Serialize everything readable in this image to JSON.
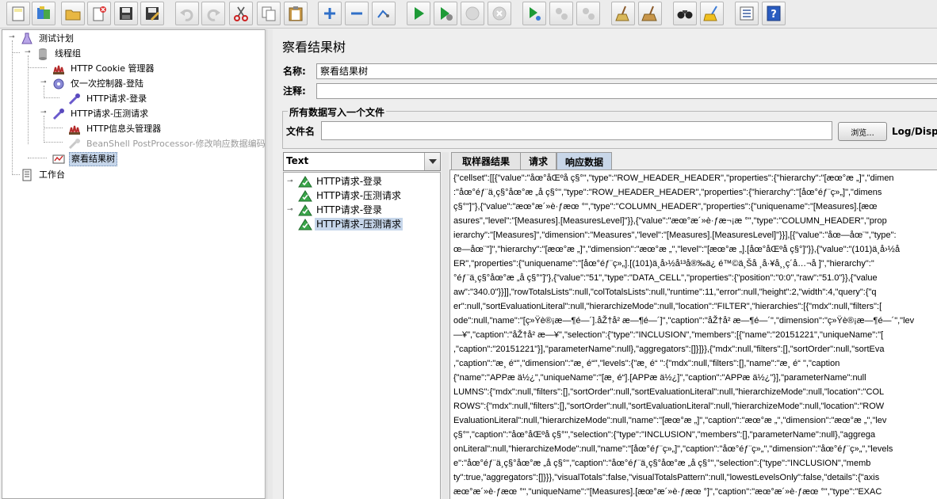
{
  "colors": {
    "selection": "#c6d6ea",
    "run_green": "#1d9a36",
    "disabled_text": "#9a9a9a"
  },
  "toolbar": {
    "buttons": [
      {
        "name": "new-button",
        "icon": "new-icon"
      },
      {
        "name": "templates-button",
        "icon": "templates-icon"
      },
      {
        "name": "open-button",
        "icon": "open-folder-icon"
      },
      {
        "name": "close-button",
        "icon": "close-file-icon"
      },
      {
        "name": "save-button",
        "icon": "save-icon"
      },
      {
        "name": "save-as-button",
        "icon": "save-as-icon"
      },
      {
        "name": "undo-button",
        "icon": "undo-icon"
      },
      {
        "name": "redo-button",
        "icon": "redo-icon"
      },
      {
        "name": "cut-button",
        "icon": "scissors-icon"
      },
      {
        "name": "copy-button",
        "icon": "copy-icon"
      },
      {
        "name": "paste-button",
        "icon": "paste-icon"
      },
      {
        "name": "expand-button",
        "icon": "plus-icon"
      },
      {
        "name": "collapse-button",
        "icon": "minus-icon"
      },
      {
        "name": "toggle-button",
        "icon": "toggle-icon"
      },
      {
        "name": "start-button",
        "icon": "play-icon"
      },
      {
        "name": "start-no-pause-button",
        "icon": "play-no-pause-icon"
      },
      {
        "name": "stop-button",
        "icon": "stop-icon"
      },
      {
        "name": "shutdown-button",
        "icon": "shutdown-icon"
      },
      {
        "name": "remote-start-button",
        "icon": "remote-play-icon"
      },
      {
        "name": "remote-stop-button",
        "icon": "remote-stop-icon"
      },
      {
        "name": "remote-shutdown-button",
        "icon": "remote-shutdown-icon"
      },
      {
        "name": "clear-button",
        "icon": "broom-icon"
      },
      {
        "name": "clear-all-button",
        "icon": "broom-all-icon"
      },
      {
        "name": "search-button",
        "icon": "binoculars-icon"
      },
      {
        "name": "reset-search-button",
        "icon": "reset-broom-icon"
      },
      {
        "name": "function-helper-button",
        "icon": "list-icon"
      },
      {
        "name": "help-button",
        "icon": "help-icon"
      }
    ]
  },
  "tree": {
    "items": [
      {
        "label": "测试计划",
        "icon": "test-plan-icon",
        "disabled": false,
        "selected": false
      },
      {
        "label": "线程组",
        "icon": "thread-group-icon",
        "disabled": false,
        "selected": false
      },
      {
        "label": "HTTP Cookie 管理器",
        "icon": "config-element-icon",
        "disabled": false,
        "selected": false
      },
      {
        "label": "仅一次控制器-登陆",
        "icon": "controller-icon",
        "disabled": false,
        "selected": false
      },
      {
        "label": "HTTP请求-登录",
        "icon": "sampler-pipette-icon",
        "disabled": false,
        "selected": false
      },
      {
        "label": "HTTP请求-压测请求",
        "icon": "sampler-pipette-icon",
        "disabled": false,
        "selected": false
      },
      {
        "label": "HTTP信息头管理器",
        "icon": "config-element-icon",
        "disabled": false,
        "selected": false
      },
      {
        "label": "BeanShell PostProcessor-修改响应数据编码",
        "icon": "postprocessor-icon",
        "disabled": true,
        "selected": false
      },
      {
        "label": "察看结果树",
        "icon": "listener-icon",
        "disabled": false,
        "selected": true
      },
      {
        "label": "工作台",
        "icon": "workbench-icon",
        "disabled": false,
        "selected": false
      }
    ]
  },
  "panel": {
    "title": "察看结果树",
    "name_label": "名称:",
    "name_value": "察看结果树",
    "comment_label": "注释:",
    "comment_value": "",
    "file_group_title": "所有数据写入一个文件",
    "filename_label": "文件名",
    "filename_value": "",
    "browse_label": "浏览...",
    "log_display_label": "Log/Disp"
  },
  "renderer": {
    "selected": "Text"
  },
  "results": {
    "items": [
      {
        "label": "HTTP请求-登录",
        "expandable": true,
        "selected": false
      },
      {
        "label": "HTTP请求-压测请求",
        "expandable": false,
        "selected": false
      },
      {
        "label": "HTTP请求-登录",
        "expandable": true,
        "selected": false
      },
      {
        "label": "HTTP请求-压测请求",
        "expandable": false,
        "selected": true
      }
    ]
  },
  "tabs": [
    {
      "label": "取样器结果",
      "active": false
    },
    {
      "label": "请求",
      "active": false
    },
    {
      "label": "响应数据",
      "active": true
    }
  ],
  "response": {
    "lines": [
      "{\"cellset\":[[{\"value\":\"åœ°åŒºå    ç§°\",\"type\":\"ROW_HEADER_HEADER\",\"properties\":{\"hierarchy\":\"[æœ°æ  „]\",\"dimen",
      ":\"åœ°éƒ¨ä¸ç§°åœ°æ  „å    ç§°\",\"type\":\"ROW_HEADER_HEADER\",\"properties\":{\"hierarchy\":\"[åœ°éƒ¨ç»„]\",\"dimens",
      "   ç§°\"]\"},{\"value\":\"æœ°æ´»è·ƒæœ  °\",\"type\":\"COLUMN_HEADER\",\"properties\":{\"uniquename\":\"[Measures].[æœ",
      "asures\",\"level\":\"[Measures].[MeasuresLevel]\"}},{\"value\":\"æœ°æ´»è·ƒæ¬¡æ  °\",\"type\":\"COLUMN_HEADER\",\"prop",
      "ierarchy\":\"[Measures]\",\"dimension\":\"Measures\",\"level\":\"[Measures].[MeasuresLevel]\"}}],[{\"value\":\"åœ—åœ¨\",\"type\":",
      "œ—åœ¨\"]\",\"hierarchy\":\"[æœ°æ  „]\",\"dimension\":\"æœ°æ  „\",\"level\":\"[æœ°æ  „].[åœ°åŒºå    ç§°]\"}},{\"value\":\"(101)ä¸­å›½å",
      "ER\",\"properties\":{\"uniquename\":\"[åœ°éƒ¨ç»„].[(101)ä¸­å›½å¹³å®‰ä¿  é™©ä¸Šå  ¸å·¥å¸¸ç´å…¬å  ]\",\"hierarchy\":\"",
      "°éƒ¨ä¸ç§°åœ°æ  „å    ç§°\"]\"},{\"value\":\"51\",\"type\":\"DATA_CELL\",\"properties\":{\"position\":\"0:0\",\"raw\":\"51.0\"}},{\"value",
      "aw\":\"340.0\"}}]],\"rowTotalsLists\":null,\"colTotalsLists\":null,\"runtime\":11,\"error\":null,\"height\":2,\"width\":4,\"query\":{\"q",
      "er\":null,\"sortEvaluationLiteral\":null,\"hierarchizeMode\":null,\"location\":\"FILTER\",\"hierarchies\":[{\"mdx\":null,\"filters\":[",
      "ode\":null,\"name\":\"[ç»Ÿè®¡æ—¶é—´].åŽ†å² æ—¶é—´]\",\"caption\":\"åŽ†å² æ—¶é—´\",\"dimension\":\"ç»Ÿè®¡æ—¶é—´\",\"lev",
      "—¥\",\"caption\":\"åŽ†å² æ—¥\",\"selection\":{\"type\":\"INCLUSION\",\"members\":[{\"name\":\"20151221\",\"uniqueName\":\"[",
      ",\"caption\":\"20151221\"}],\"parameterName\":null},\"aggregators\":[]}]}},{\"mdx\":null,\"filters\":[],\"sortOrder\":null,\"sortEva",
      ",\"caption\":\"æ¸ é“\",\"dimension\":\"æ¸ é“\",\"levels\":{\"æ¸ é“  \":{\"mdx\":null,\"filters\":[],\"name\":\"æ¸ é“  \",\"caption",
      "{\"name\":\"APPæ  ä½¿\",\"uniqueName\":\"[æ¸ é“].[APPæ  ä½¿]\",\"caption\":\"APPæ  ä½¿\"}],\"parameterName\":null",
      "LUMNS\":{\"mdx\":null,\"filters\":[],\"sortOrder\":null,\"sortEvaluationLiteral\":null,\"hierarchizeMode\":null,\"location\":\"COL",
      "ROWS\":{\"mdx\":null,\"filters\":[],\"sortOrder\":null,\"sortEvaluationLiteral\":null,\"hierarchizeMode\":null,\"location\":\"ROW",
      "EvaluationLiteral\":null,\"hierarchizeMode\":null,\"name\":\"[æœ°æ  „]\",\"caption\":\"æœ°æ  „\",\"dimension\":\"æœ°æ  „\",\"lev",
      "   ç§°\",\"caption\":\"åœ°åŒºå    ç§°\",\"selection\":{\"type\":\"INCLUSION\",\"members\":[],\"parameterName\":null},\"aggrega",
      "onLiteral\":null,\"hierarchizeMode\":null,\"name\":\"[åœ°éƒ¨ç»„]\",\"caption\":\"åœ°éƒ¨ç»„\",\"dimension\":\"åœ°éƒ¨ç»„\",\"levels",
      "e\":\"åœ°éƒ¨ä¸ç§°åœ°æ  „å    ç§°\",\"caption\":\"åœ°éƒ¨ä¸ç§°åœ°æ  „å    ç§°\",\"selection\":{\"type\":\"INCLUSION\",\"memb",
      "ty\":true,\"aggregators\":[]}}},\"visualTotals\":false,\"visualTotalsPattern\":null,\"lowestLevelsOnly\":false,\"details\":{\"axis",
      "æœ°æ´»è·ƒæœ  °\",\"uniqueName\":\"[Measures].[æœ°æ´»è·ƒæœ  °]\",\"caption\":\"æœ°æ´»è·ƒæœ  °\",\"type\":\"EXAC"
    ]
  }
}
